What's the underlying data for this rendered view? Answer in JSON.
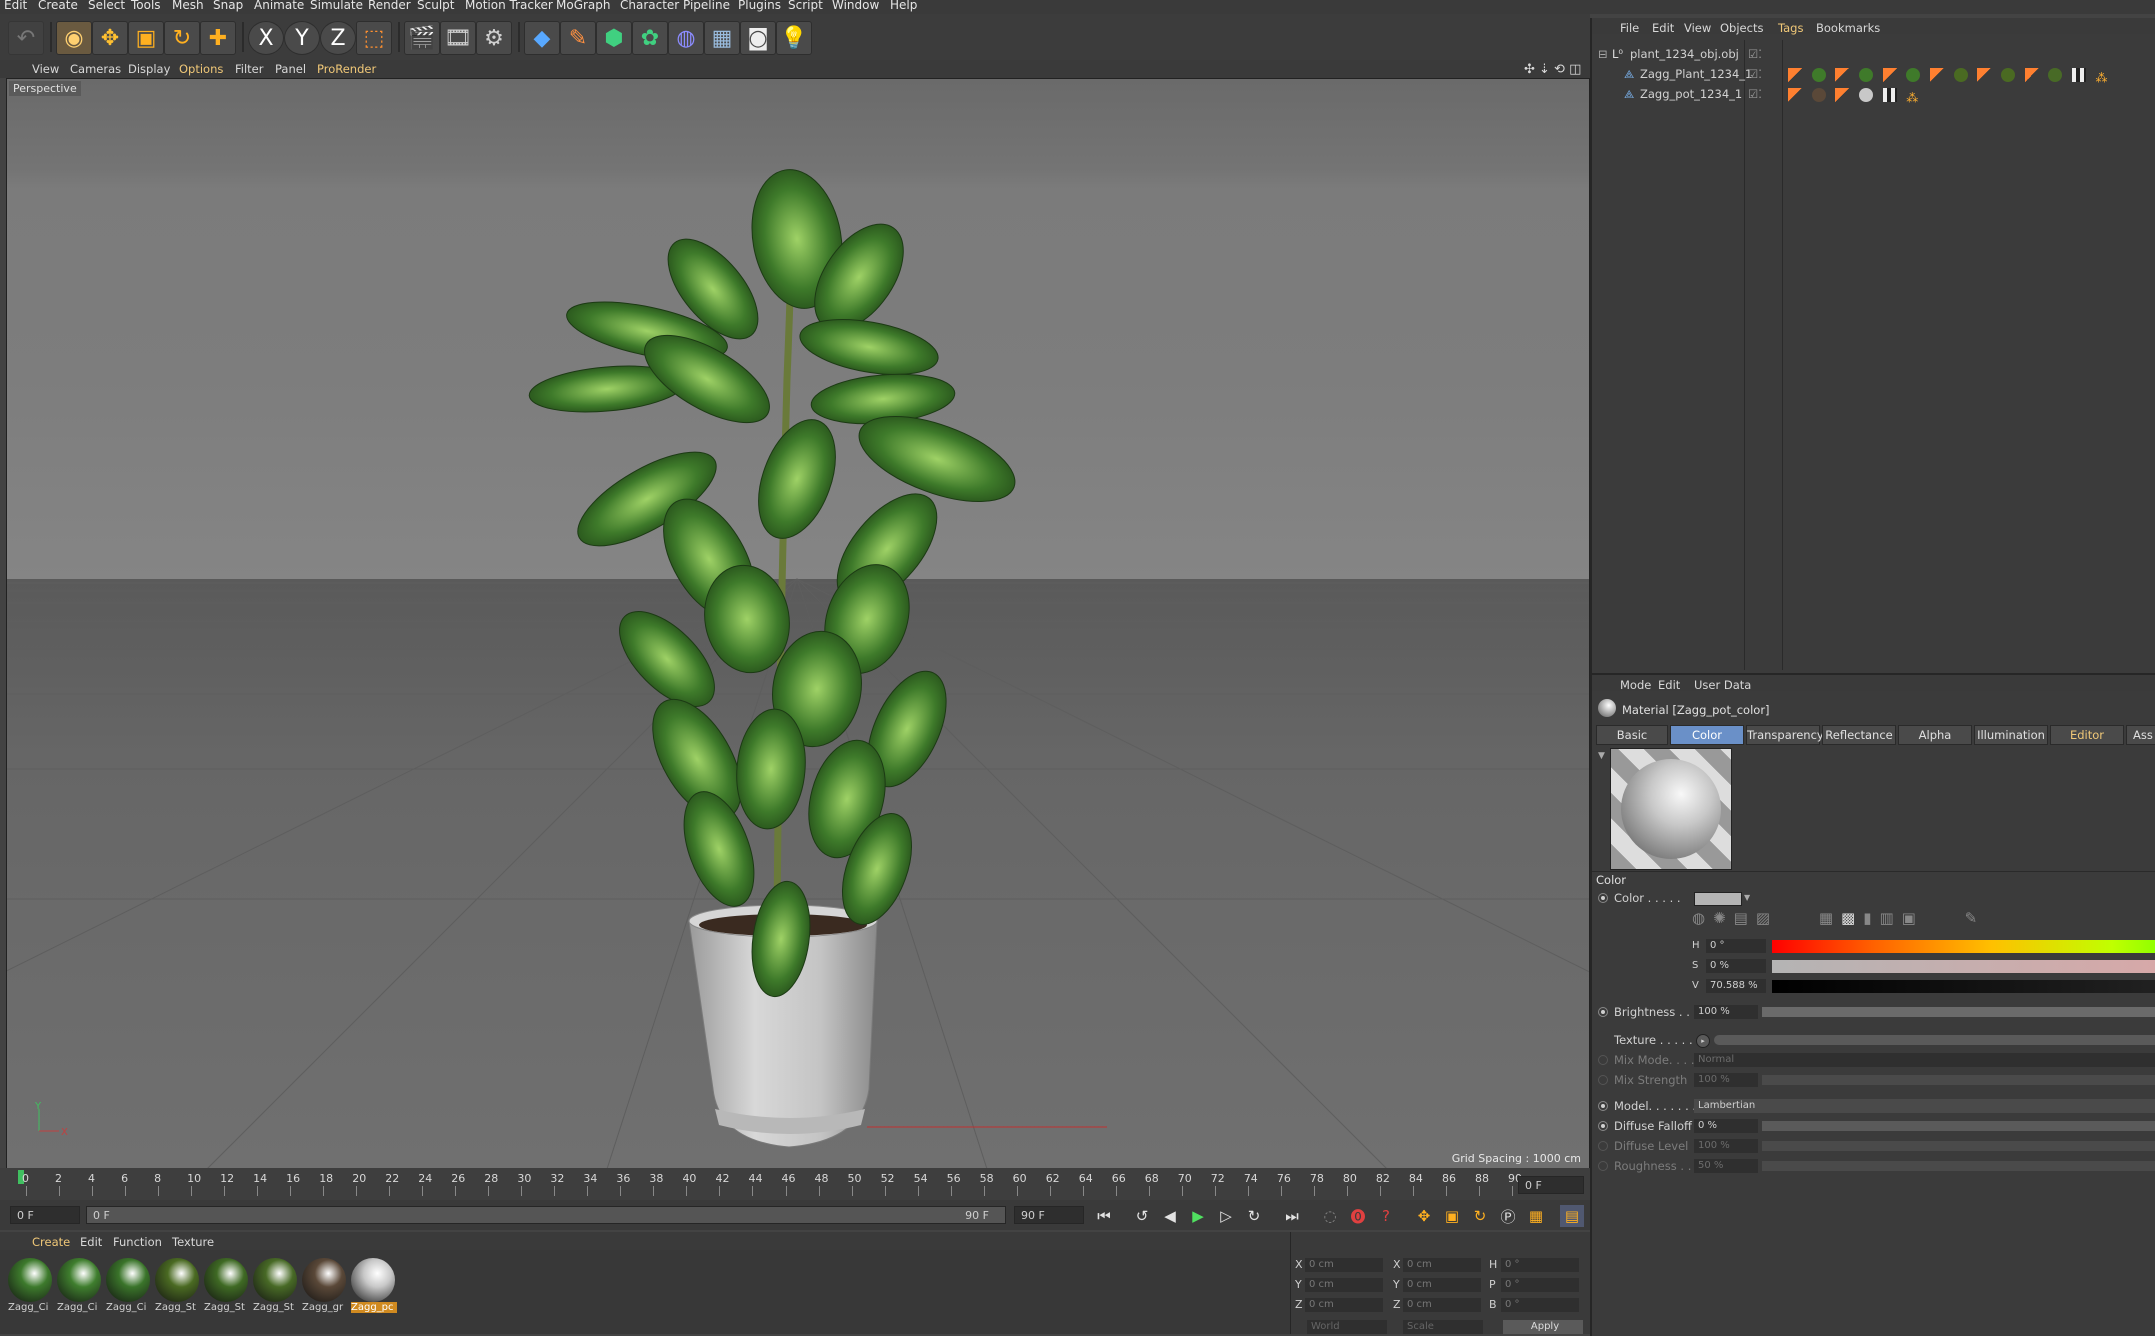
{
  "menubar": {
    "items": [
      "Edit",
      "Create",
      "Select",
      "Tools",
      "Mesh",
      "Snap",
      "Animate",
      "Simulate",
      "Render",
      "Sculpt",
      "Motion Tracker",
      "MoGraph",
      "Character",
      "Pipeline",
      "Plugins",
      "Script",
      "Window",
      "Help"
    ]
  },
  "toolbar": {
    "axis_x": "X",
    "axis_y": "Y",
    "axis_z": "Z"
  },
  "viewport": {
    "menu": [
      "View",
      "Cameras",
      "Display",
      "Options",
      "Filter",
      "Panel",
      "ProRender"
    ],
    "label": "Perspective",
    "grid_spacing": "Grid Spacing : 1000 cm",
    "axis_y_label": "Y",
    "axis_x_label": "X"
  },
  "timeline": {
    "ticks": [
      "0",
      "2",
      "4",
      "6",
      "8",
      "10",
      "12",
      "14",
      "16",
      "18",
      "20",
      "22",
      "24",
      "26",
      "28",
      "30",
      "32",
      "34",
      "36",
      "38",
      "40",
      "42",
      "44",
      "46",
      "48",
      "50",
      "52",
      "54",
      "56",
      "58",
      "60",
      "62",
      "64",
      "66",
      "68",
      "70",
      "72",
      "74",
      "76",
      "78",
      "80",
      "82",
      "84",
      "86",
      "88",
      "90"
    ],
    "frame_readout": "0 F"
  },
  "transport": {
    "start_field": "0 F",
    "range_start": "0 F",
    "range_end": "90 F",
    "end_field": "90 F"
  },
  "material_manager": {
    "menu": [
      "Create",
      "Edit",
      "Function",
      "Texture"
    ],
    "materials": [
      {
        "label": "Zagg_Ci",
        "color": "#3d7a2c"
      },
      {
        "label": "Zagg_Ci",
        "color": "#3f7e2e"
      },
      {
        "label": "Zagg_Ci",
        "color": "#3a742a"
      },
      {
        "label": "Zagg_St",
        "color": "#4a6a22"
      },
      {
        "label": "Zagg_St",
        "color": "#3f6a24"
      },
      {
        "label": "Zagg_St",
        "color": "#486a26"
      },
      {
        "label": "Zagg_gr",
        "color": "#5a4838"
      },
      {
        "label": "Zagg_pc",
        "color": "#c8c8c8"
      }
    ]
  },
  "coordinates": {
    "rows": [
      {
        "a": "X",
        "av": "0 cm",
        "b": "X",
        "bv": "0 cm",
        "c": "H",
        "cv": "0 °"
      },
      {
        "a": "Y",
        "av": "0 cm",
        "b": "Y",
        "bv": "0 cm",
        "c": "P",
        "cv": "0 °"
      },
      {
        "a": "Z",
        "av": "0 cm",
        "b": "Z",
        "bv": "0 cm",
        "c": "B",
        "cv": "0 °"
      }
    ],
    "world": "World",
    "scale": "Scale",
    "apply": "Apply"
  },
  "object_manager": {
    "menu": [
      "File",
      "Edit",
      "View",
      "Objects",
      "Tags",
      "Bookmarks"
    ],
    "objects": [
      {
        "name": "plant_1234_obj.obj"
      },
      {
        "name": "Zagg_Plant_1234_1"
      },
      {
        "name": "Zagg_pot_1234_1"
      }
    ]
  },
  "attribute_manager": {
    "menu": [
      "Mode",
      "Edit",
      "User Data"
    ],
    "title": "Material [Zagg_pot_color]",
    "tabs": [
      "Basic",
      "Color",
      "Transparency",
      "Reflectance",
      "Alpha",
      "Illumination",
      "Editor",
      "Ass"
    ],
    "active_tab": "Color",
    "section": "Color",
    "color_label": "Color . . . . .",
    "h_label": "H",
    "h_value": "0 °",
    "s_label": "S",
    "s_value": "0 %",
    "v_label": "V",
    "v_value": "70.588 %",
    "brightness_label": "Brightness . . .",
    "brightness_value": "100 %",
    "texture_label": "Texture . . . . . .",
    "mix_mode_label": "Mix Mode. . . .",
    "mix_mode_value": "Normal",
    "mix_strength_label": "Mix Strength",
    "mix_strength_value": "100 %",
    "model_label": "Model. . . . . . .",
    "model_value": "Lambertian",
    "diffuse_falloff_label": "Diffuse Falloff",
    "diffuse_falloff_value": "0 %",
    "diffuse_level_label": "Diffuse Level",
    "diffuse_level_value": "100 %",
    "roughness_label": "Roughness . .",
    "roughness_value": "50 %",
    "swatch_color": "#b4b4b4"
  },
  "colors": {
    "accent": "#f0c878",
    "tab_active": "#6a90c8",
    "ui_bg": "#3b3b3b"
  }
}
